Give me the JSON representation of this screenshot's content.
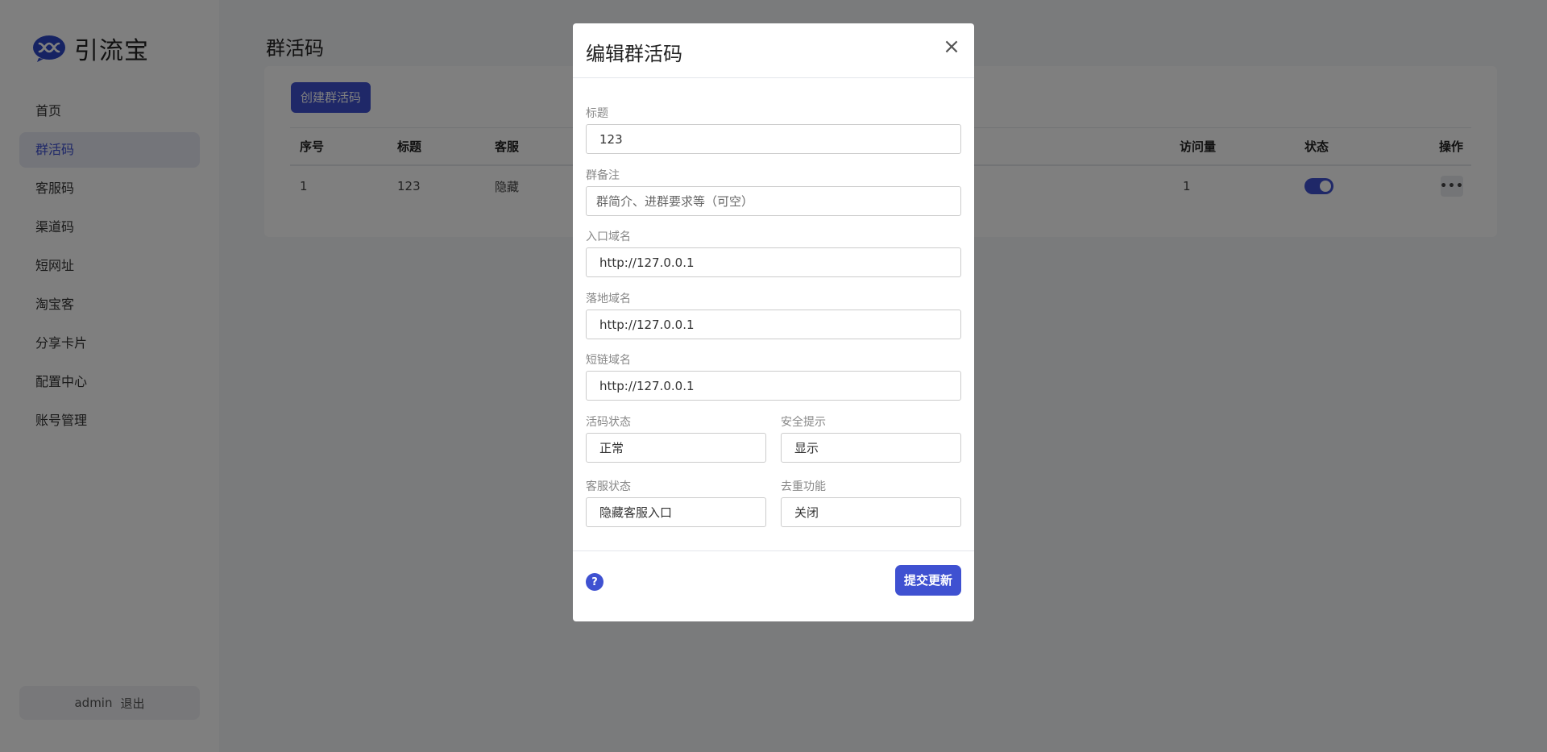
{
  "app": {
    "name": "引流宝"
  },
  "sidebar": {
    "items": [
      {
        "label": "首页"
      },
      {
        "label": "群活码"
      },
      {
        "label": "客服码"
      },
      {
        "label": "渠道码"
      },
      {
        "label": "短网址"
      },
      {
        "label": "淘宝客"
      },
      {
        "label": "分享卡片"
      },
      {
        "label": "配置中心"
      },
      {
        "label": "账号管理"
      }
    ],
    "active_index": 1,
    "user": "admin",
    "logout_label": "退出"
  },
  "page": {
    "title": "群活码",
    "create_label": "创建群活码",
    "table": {
      "headers": [
        "序号",
        "标题",
        "客服",
        "访问量",
        "状态",
        "操作"
      ],
      "rows": [
        {
          "index": "1",
          "title": "123",
          "service": "隐藏",
          "visits": "1",
          "status_on": true
        }
      ]
    }
  },
  "modal": {
    "title": "编辑群活码",
    "close_glyph": "×",
    "fields": {
      "title": {
        "label": "标题",
        "value": "123"
      },
      "note": {
        "label": "群备注",
        "placeholder": "群简介、进群要求等（可空）"
      },
      "entry_domain": {
        "label": "入口域名",
        "value": "http://127.0.0.1"
      },
      "landing_domain": {
        "label": "落地域名",
        "value": "http://127.0.0.1"
      },
      "short_domain": {
        "label": "短链域名",
        "value": "http://127.0.0.1"
      },
      "qr_status": {
        "label": "活码状态",
        "value": "正常"
      },
      "security_tip": {
        "label": "安全提示",
        "value": "显示"
      },
      "service_status": {
        "label": "客服状态",
        "value": "隐藏客服入口"
      },
      "dedup": {
        "label": "去重功能",
        "value": "关闭"
      }
    },
    "help_glyph": "?",
    "submit_label": "提交更新"
  },
  "colors": {
    "accent": "#3f51d1",
    "overlay": "rgba(0,0,0,0.5)"
  }
}
